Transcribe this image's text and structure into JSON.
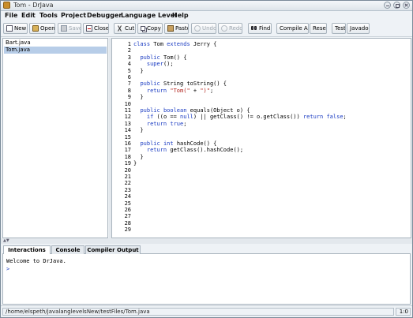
{
  "window": {
    "title": "Tom - DrJava"
  },
  "menu": [
    "File",
    "Edit",
    "Tools",
    "Project",
    "Debugger",
    "Language Level",
    "Help"
  ],
  "toolbar": {
    "new": "New",
    "open": "Open",
    "save": "Save",
    "close": "Close",
    "cut": "Cut",
    "copy": "Copy",
    "paste": "Paste",
    "undo": "Undo",
    "redo": "Redo",
    "find": "Find",
    "compile_all": "Compile All",
    "reset": "Reset",
    "test": "Test",
    "javadoc": "Javadoc"
  },
  "files": [
    {
      "name": "Bart.java",
      "selected": false
    },
    {
      "name": "Tom.java",
      "selected": true
    }
  ],
  "editor": {
    "line_numbers": [
      "1",
      "2",
      "3",
      "4",
      "5",
      "6",
      "7",
      "8",
      "9",
      "10",
      "11",
      "12",
      "13",
      "14",
      "15",
      "16",
      "17",
      "18",
      "19",
      "20",
      "21",
      "22",
      "23",
      "24",
      "25",
      "26",
      "27",
      "28",
      "29"
    ],
    "lines": [
      "class Tom extends Jerry {",
      "",
      "  public Tom() {",
      "    super();",
      "  }",
      "",
      "  public String toString() {",
      "    return \"Tom(\" + \")\";",
      "  }",
      "",
      "  public boolean equals(Object o) {",
      "    if ((o == null) || getClass() != o.getClass()) return false;",
      "    return true;",
      "  }",
      "",
      "  public int hashCode() {",
      "    return getClass().hashCode();",
      "  }",
      "}"
    ]
  },
  "tabs": [
    "Interactions",
    "Console",
    "Compiler Output"
  ],
  "interactions": {
    "welcome": "Welcome to DrJava.",
    "prompt": ">"
  },
  "status": {
    "path": "/home/elspeth/javalanglevelsNew/testFiles/Tom.java",
    "position": "1:0"
  },
  "colors": {
    "keyword": "#1a3bc2",
    "string": "#b0201a",
    "selection": "#b7cde8"
  }
}
